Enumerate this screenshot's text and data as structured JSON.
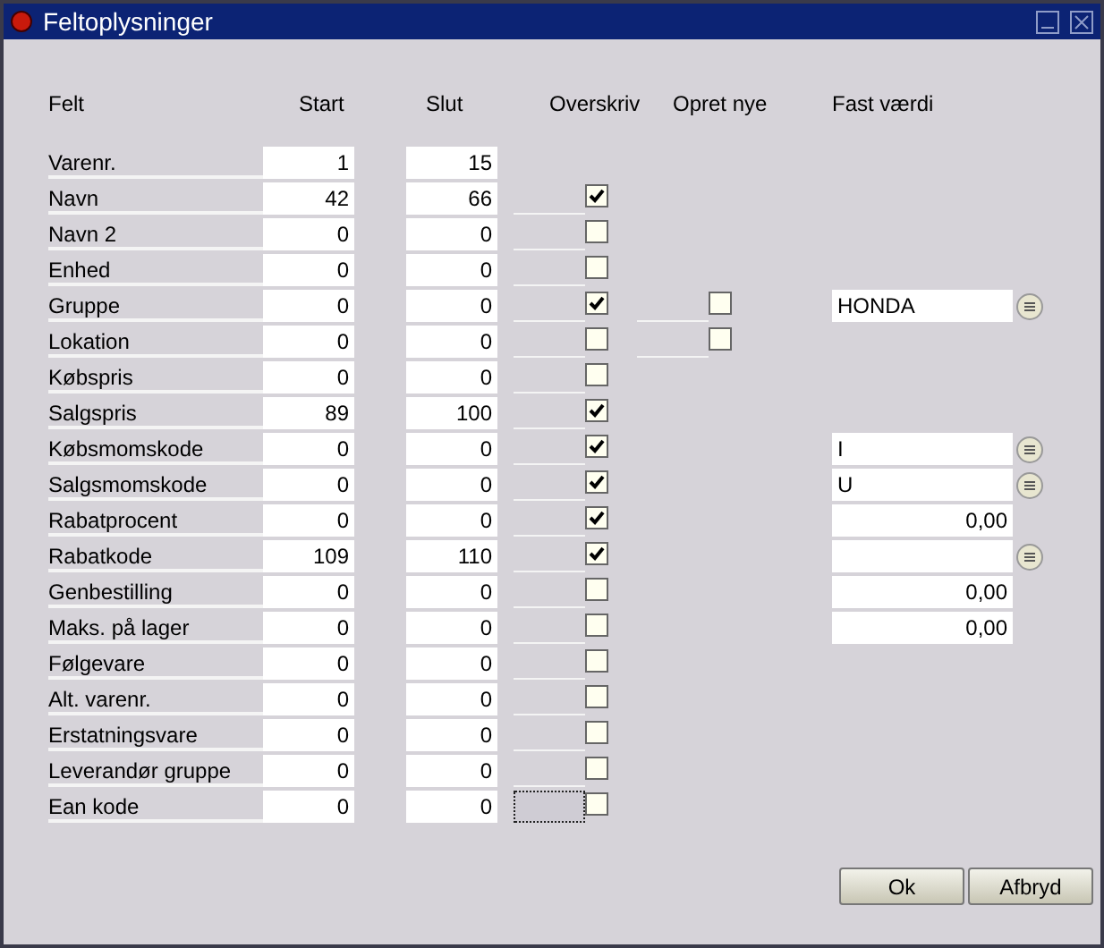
{
  "window": {
    "title": "Feltoplysninger"
  },
  "columns": {
    "field": "Felt",
    "start": "Start",
    "end": "Slut",
    "overwrite": "Overskriv",
    "create_new": "Opret nye",
    "fixed_value": "Fast værdi"
  },
  "rows": [
    {
      "label": "Varenr.",
      "start": "1",
      "end": "15"
    },
    {
      "label": "Navn",
      "start": "42",
      "end": "66",
      "overwrite": true,
      "focused": false
    },
    {
      "label": "Navn 2",
      "start": "0",
      "end": "0",
      "overwrite": false,
      "focused": false
    },
    {
      "label": "Enhed",
      "start": "0",
      "end": "0",
      "overwrite": false,
      "focused": false
    },
    {
      "label": "Gruppe",
      "start": "0",
      "end": "0",
      "overwrite": true,
      "create_new": false,
      "fixed": {
        "kind": "lookup",
        "value": "HONDA"
      },
      "focused": false
    },
    {
      "label": "Lokation",
      "start": "0",
      "end": "0",
      "overwrite": false,
      "create_new": false,
      "focused": false
    },
    {
      "label": "Købspris",
      "start": "0",
      "end": "0",
      "overwrite": false,
      "focused": false
    },
    {
      "label": "Salgspris",
      "start": "89",
      "end": "100",
      "overwrite": true,
      "focused": false
    },
    {
      "label": "Købsmomskode",
      "start": "0",
      "end": "0",
      "overwrite": true,
      "fixed": {
        "kind": "lookup",
        "value": "I"
      },
      "focused": false
    },
    {
      "label": "Salgsmomskode",
      "start": "0",
      "end": "0",
      "overwrite": true,
      "fixed": {
        "kind": "lookup",
        "value": "U"
      },
      "focused": false
    },
    {
      "label": "Rabatprocent",
      "start": "0",
      "end": "0",
      "overwrite": true,
      "fixed": {
        "kind": "number",
        "value": "0,00"
      },
      "focused": false
    },
    {
      "label": "Rabatkode",
      "start": "109",
      "end": "110",
      "overwrite": true,
      "fixed": {
        "kind": "lookup"
      },
      "focused": false
    },
    {
      "label": "Genbestilling",
      "start": "0",
      "end": "0",
      "overwrite": false,
      "fixed": {
        "kind": "number",
        "value": "0,00"
      },
      "focused": false
    },
    {
      "label": "Maks. på lager",
      "start": "0",
      "end": "0",
      "overwrite": false,
      "fixed": {
        "kind": "number",
        "value": "0,00"
      },
      "focused": false
    },
    {
      "label": "Følgevare",
      "start": "0",
      "end": "0",
      "overwrite": false,
      "focused": false
    },
    {
      "label": "Alt. varenr.",
      "start": "0",
      "end": "0",
      "overwrite": false,
      "focused": false
    },
    {
      "label": "Erstatningsvare",
      "start": "0",
      "end": "0",
      "overwrite": false,
      "focused": false
    },
    {
      "label": "Leverandør gruppe",
      "start": "0",
      "end": "0",
      "overwrite": false,
      "focused": false
    },
    {
      "label": "Ean kode",
      "start": "0",
      "end": "0",
      "overwrite": false,
      "focused": true
    }
  ],
  "buttons": [
    "Ok",
    "Afbryd"
  ]
}
